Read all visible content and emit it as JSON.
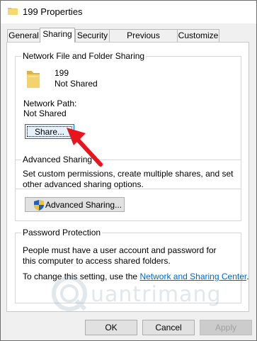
{
  "window": {
    "title": "199 Properties"
  },
  "tabs": [
    {
      "label": "General"
    },
    {
      "label": "Sharing"
    },
    {
      "label": "Security"
    },
    {
      "label": "Previous Versions"
    },
    {
      "label": "Customize"
    }
  ],
  "network_sharing": {
    "group_title": "Network File and Folder Sharing",
    "folder_name": "199",
    "folder_status": "Not Shared",
    "path_label": "Network Path:",
    "path_value": "Not Shared",
    "share_button": "Share..."
  },
  "advanced_sharing": {
    "group_title": "Advanced Sharing",
    "description": "Set custom permissions, create multiple shares, and set other advanced sharing options.",
    "button": "Advanced Sharing..."
  },
  "password_protection": {
    "group_title": "Password Protection",
    "description": "People must have a user account and password for this computer to access shared folders.",
    "change_text": "To change this setting, use the",
    "link": "Network and Sharing Center",
    "suffix": "."
  },
  "footer": {
    "ok": "OK",
    "cancel": "Cancel",
    "apply": "Apply"
  },
  "watermark": {
    "text": "uantrimang"
  },
  "colors": {
    "accent": "#0078d7",
    "link": "#0066cc",
    "arrow": "#e8141e"
  }
}
